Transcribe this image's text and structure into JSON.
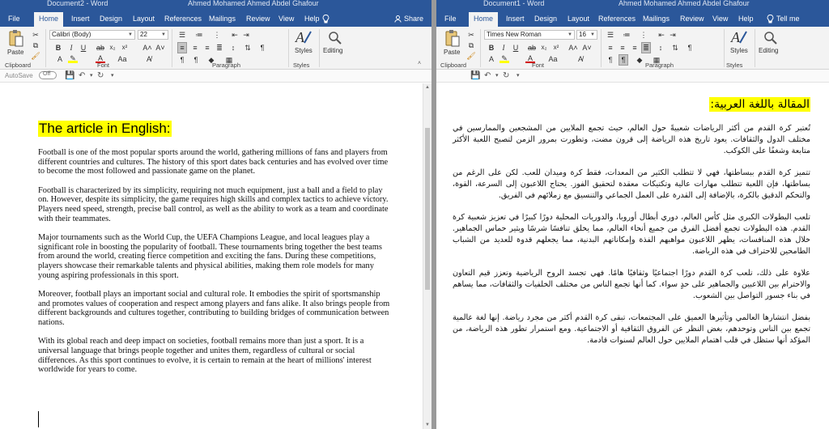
{
  "left": {
    "title_left": "Document2 - Word",
    "title_user": "Ahmed Mohamed Ahmed Abdel Ghafour",
    "tabs": [
      "File",
      "Home",
      "Insert",
      "Design",
      "Layout",
      "References",
      "Mailings",
      "Review",
      "View",
      "Help"
    ],
    "share": "Share",
    "font_name": "Calibri (Body)",
    "font_size": "22",
    "groups": {
      "clipboard": "Clipboard",
      "font": "Font",
      "paragraph": "Paragraph",
      "styles": "Styles"
    },
    "paste": "Paste",
    "styles_btn": "Styles",
    "editing_btn": "Editing",
    "autosave": "AutoSave",
    "autosave_state": "Off",
    "heading": "The article in English:",
    "paragraphs": [
      "Football is one of the most popular sports around the world, gathering millions of fans and players from different countries and cultures. The history of this sport dates back centuries and has evolved over time to become the most followed and passionate game on the planet.",
      "Football is characterized by its simplicity, requiring not much equipment, just a ball and a field to play on. However, despite its simplicity, the game requires high skills and complex tactics to achieve victory. Players need speed, strength, precise ball control, as well as the ability to work as a team and coordinate with their teammates.",
      "Major tournaments such as the World Cup, the UEFA Champions League, and local leagues play a significant role in boosting the popularity of football. These tournaments bring together the best teams from around the world, creating fierce competition and exciting the fans. During these competitions, players showcase their remarkable talents and physical abilities, making them role models for many young aspiring professionals in this sport.",
      "Moreover, football plays an important social and cultural role. It embodies the spirit of sportsmanship and promotes values of cooperation and respect among players and fans alike. It also brings people from different backgrounds and cultures together, contributing to building bridges of communication between nations.",
      "With its global reach and deep impact on societies, football remains more than just a sport. It is a universal language that brings people together and unites them, regardless of cultural or social differences. As this sport continues to evolve, it is certain to remain at the heart of millions' interest worldwide for years to come."
    ]
  },
  "right": {
    "title_left": "Document1 - Word",
    "title_user": "Ahmed Mohamed Ahmed Abdel Ghafour",
    "tabs": [
      "File",
      "Home",
      "Insert",
      "Design",
      "Layout",
      "References",
      "Mailings",
      "Review",
      "View",
      "Help"
    ],
    "tell_me": "Tell me",
    "font_name": "Times New Roman",
    "font_size": "16",
    "groups": {
      "clipboard": "Clipboard",
      "font": "Font",
      "paragraph": "Paragraph",
      "styles": "Styles"
    },
    "paste": "Paste",
    "styles_btn": "Styles",
    "editing_btn": "Editing",
    "heading": "المقالة باللغة العربية:",
    "paragraphs": [
      "تُعتبر كرة القدم من أكثر الرياضات شعبيةً حول العالم، حيث تجمع الملايين من المشجعين والممارسين في مختلف الدول والثقافات. يعود تاريخ هذه الرياضة إلى قرون مضت، وتطورت بمرور الزمن لتصبح اللعبة الأكثر متابعة وشغفًا على الكوكب.",
      "تتميز كرة القدم ببساطتها، فهي لا تتطلب الكثير من المعدات، فقط كرة وميدان للعب. لكن على الرغم من بساطتها، فإن اللعبة تتطلب مهارات عالية وتكتيكات معقدة لتحقيق الفوز. يحتاج اللاعبون إلى السرعة، القوة، والتحكم الدقيق بالكرة، بالإضافة إلى القدرة على العمل الجماعي والتنسيق مع زملائهم في الفريق.",
      "تلعب البطولات الكبرى مثل كأس العالم، دوري أبطال أوروبا، والدوريات المحلية دورًا كبيرًا في تعزيز شعبية كرة القدم. هذه البطولات تجمع أفضل الفرق من جميع أنحاء العالم، مما يخلق تنافسًا شرسًا ويثير حماس الجماهير. خلال هذه المنافسات، يظهر اللاعبون مواهبهم الفذة وإمكاناتهم البدنية، مما يجعلهم قدوة للعديد من الشباب الطامحين للاحتراف في هذه الرياضة.",
      "علاوة على ذلك، تلعب كرة القدم دورًا اجتماعيًا وثقافيًا هامًا. فهي تجسد الروح الرياضية وتعزز قيم التعاون والاحترام بين اللاعبين والجماهير على حدٍ سواء. كما أنها تجمع الناس من مختلف الخلفيات والثقافات، مما يساهم في بناء جسور التواصل بين الشعوب.",
      "بفضل انتشارها العالمي وتأثيرها العميق على المجتمعات، تبقى كرة القدم أكثر من مجرد رياضة. إنها لغة عالمية تجمع بين الناس وتوحدهم، بغض النظر عن الفروق الثقافية أو الاجتماعية. ومع استمرار تطور هذه الرياضة، من المؤكد أنها ستظل في قلب اهتمام الملايين حول العالم لسنوات قادمة."
    ]
  }
}
